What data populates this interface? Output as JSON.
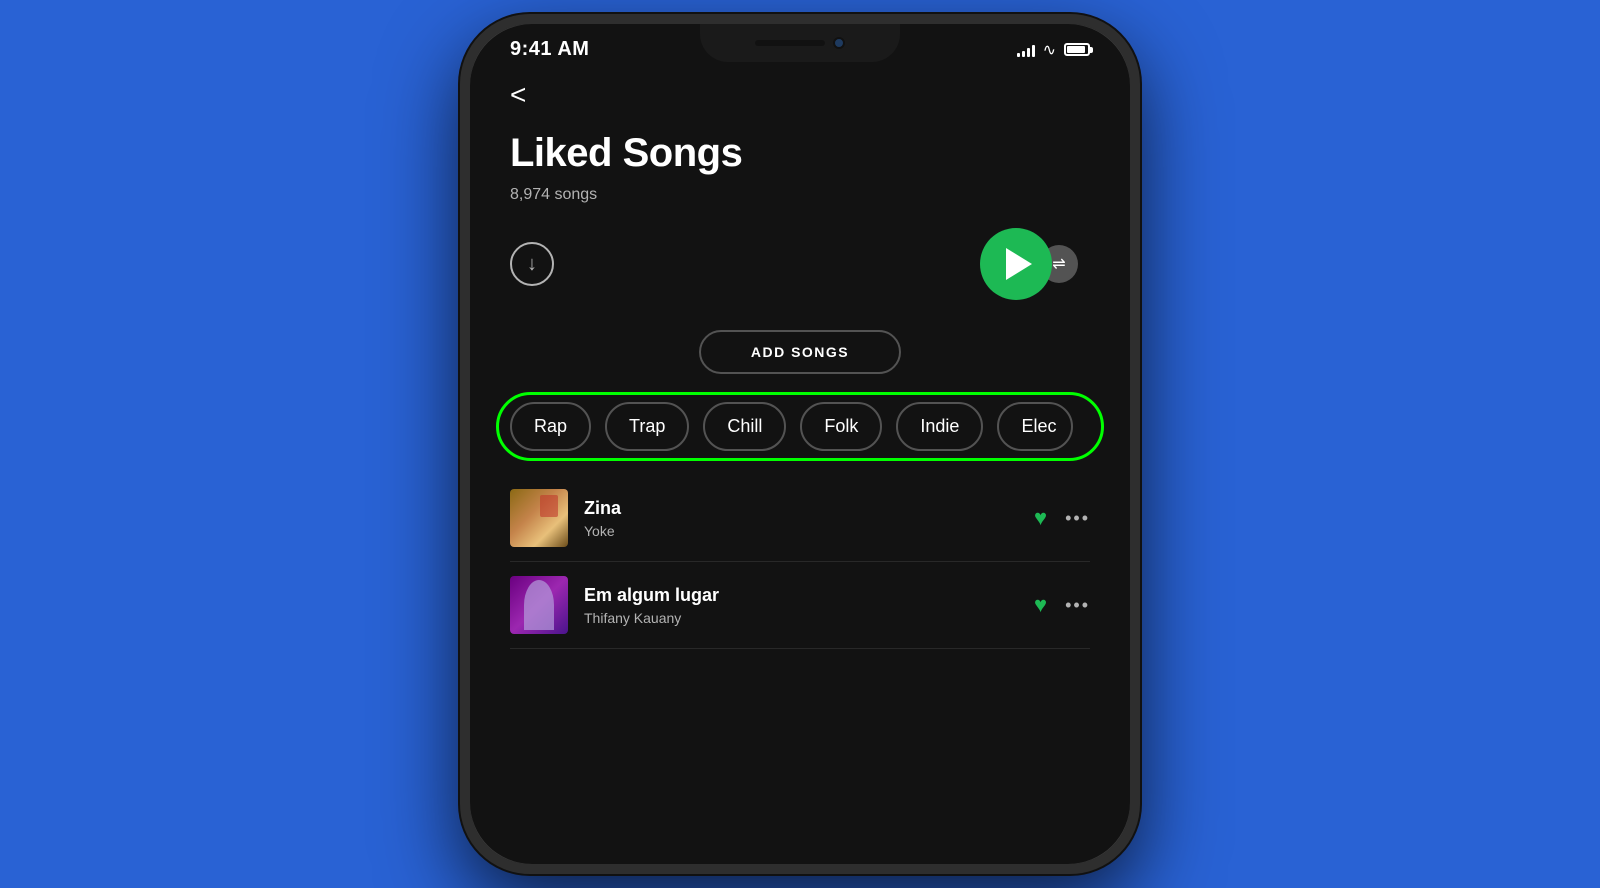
{
  "background_color": "#2962d4",
  "phone": {
    "status_bar": {
      "time": "9:41 AM",
      "signal_bars": [
        4,
        6,
        8,
        10,
        12
      ],
      "wifi": "wifi",
      "battery_level": 90
    },
    "app": {
      "back_label": "<",
      "playlist_title": "Liked Songs",
      "song_count": "8,974 songs",
      "add_songs_label": "ADD SONGS",
      "genre_chips": [
        {
          "label": "Rap"
        },
        {
          "label": "Trap"
        },
        {
          "label": "Chill"
        },
        {
          "label": "Folk"
        },
        {
          "label": "Indie"
        },
        {
          "label": "Elec"
        }
      ],
      "songs": [
        {
          "title": "Zina",
          "artist": "Yoke",
          "liked": true
        },
        {
          "title": "Em algum lugar",
          "artist": "Thifany Kauany",
          "liked": true
        }
      ]
    }
  }
}
